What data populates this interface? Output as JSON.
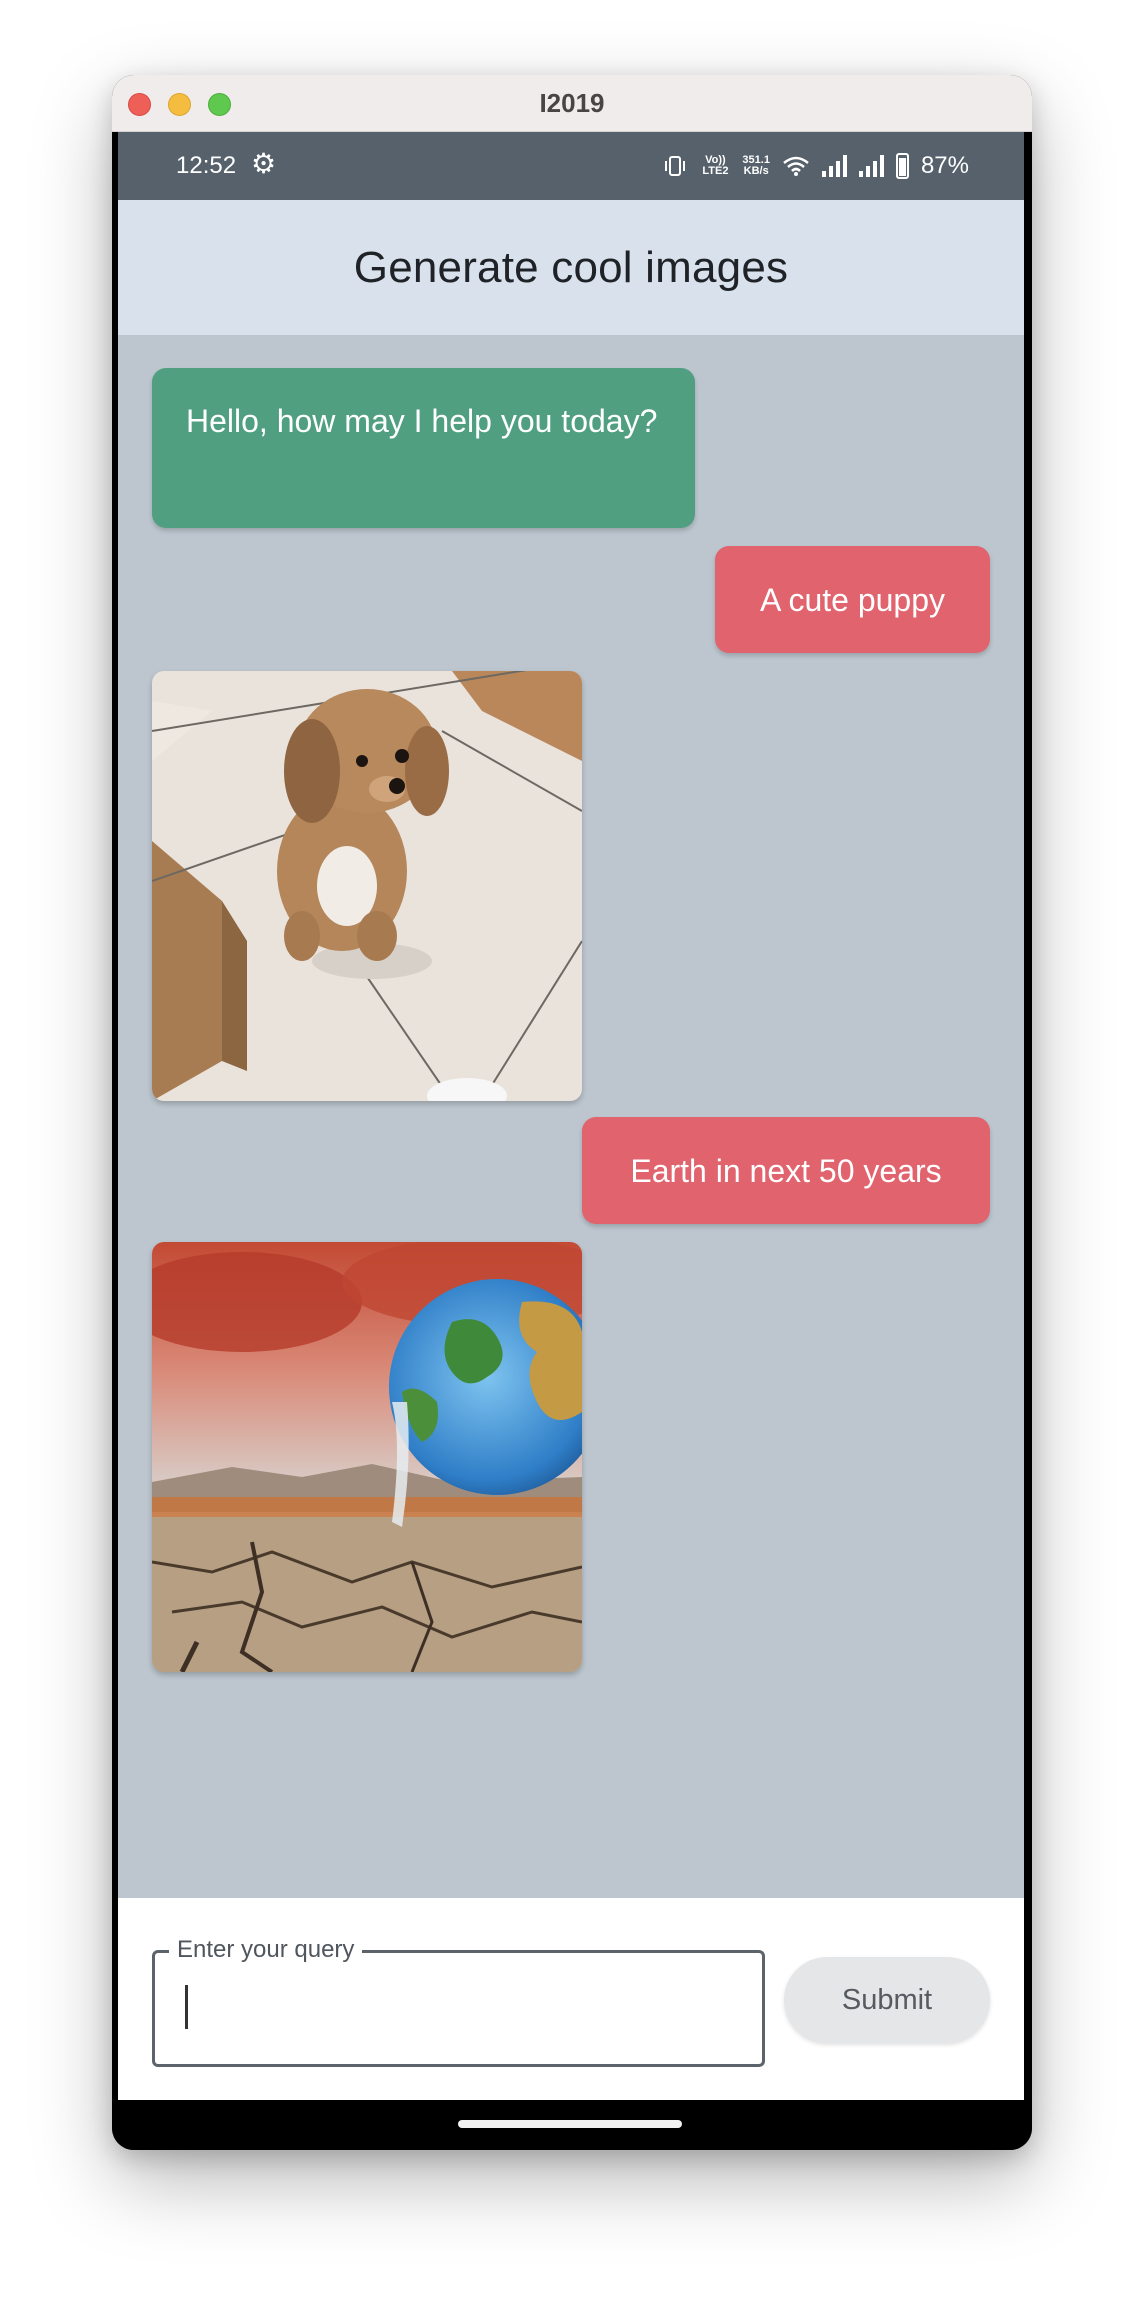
{
  "window": {
    "title": "I2019"
  },
  "status_bar": {
    "time": "12:52",
    "settings_icon": "gear-icon",
    "network_label": "Vo)) LTE2",
    "speed_value": "351.1",
    "speed_unit": "KB/s",
    "battery": "87%"
  },
  "app": {
    "title": "Generate cool images"
  },
  "chat": {
    "messages": [
      {
        "role": "bot",
        "text": "Hello, how may I help you today?"
      },
      {
        "role": "user",
        "text": "A cute puppy"
      },
      {
        "role": "image",
        "image": "puppy-photo"
      },
      {
        "role": "user",
        "text": "Earth in next 50 years"
      },
      {
        "role": "image",
        "image": "earth-melting-desert"
      }
    ]
  },
  "input": {
    "label": "Enter your query",
    "value": "",
    "placeholder": ""
  },
  "submit": {
    "label": "Submit"
  },
  "colors": {
    "bot_bubble": "#4f9f80",
    "user_bubble": "#e0636d",
    "chat_background": "#bdc6cf",
    "app_bar": "#d9e2ec",
    "status_bar": "#56616b"
  }
}
